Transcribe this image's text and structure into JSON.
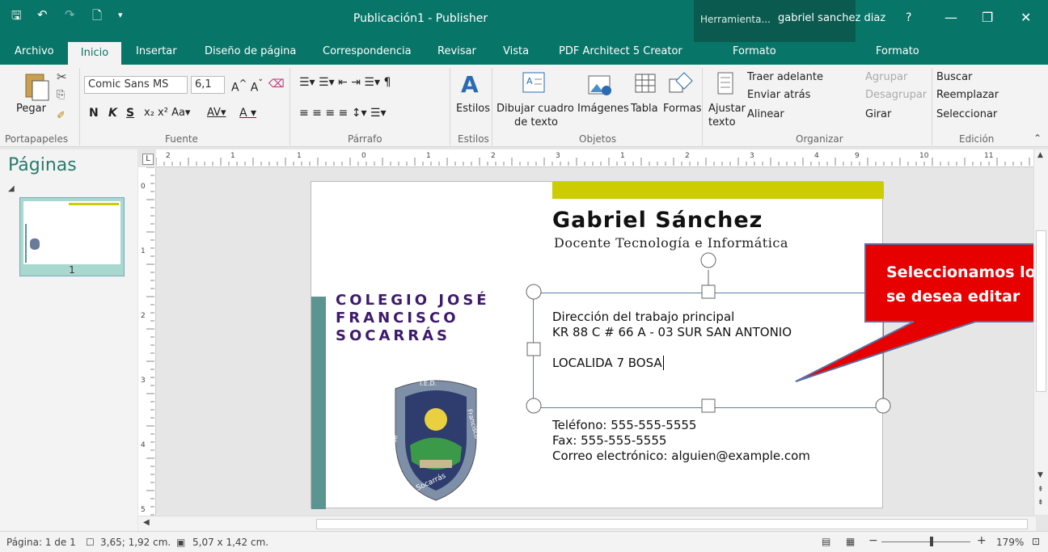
{
  "window": {
    "title": "Publicación1 - Publisher",
    "context_tab": "Herramienta...",
    "user": "gabriel sanchez diaz",
    "help": "?",
    "minimize": "—",
    "restore": "❐",
    "close": "✕"
  },
  "qat": {
    "save": "🖫",
    "undo": "↶",
    "redo": "↷",
    "new": "🗋",
    "more": "▾"
  },
  "tabs": [
    "Archivo",
    "Inicio",
    "Insertar",
    "Diseño de página",
    "Correspondencia",
    "Revisar",
    "Vista",
    "PDF Architect 5 Creator",
    "Formato",
    "Formato"
  ],
  "ribbon": {
    "pegar": "Pegar",
    "font_name": "Comic Sans MS",
    "font_size": "6,1",
    "bold": "N",
    "italic": "K",
    "underline": "S",
    "estilos": "Estilos",
    "dibujar": "Dibujar cuadro",
    "dibujar2": "de texto",
    "imagenes": "Imágenes",
    "tabla": "Tabla",
    "formas": "Formas",
    "ajustar": "Ajustar",
    "ajustar2": "texto",
    "traer": "Traer adelante",
    "enviar": "Enviar atrás",
    "alinear": "Alinear",
    "agrupar": "Agrupar",
    "desagrupar": "Desagrupar",
    "girar": "Girar",
    "buscar": "Buscar",
    "reemplazar": "Reemplazar",
    "seleccionar": "Seleccionar",
    "groups": {
      "portapapeles": "Portapapeles",
      "fuente": "Fuente",
      "parrafo": "Párrafo",
      "estilos": "Estilos",
      "objetos": "Objetos",
      "organizar": "Organizar",
      "edicion": "Edición"
    }
  },
  "ruler": {
    "corner": "L",
    "h": [
      "2",
      "1",
      "1",
      "0",
      "1",
      "2",
      "3",
      "1",
      "2",
      "3",
      "4",
      "9",
      "10",
      "11"
    ],
    "v": [
      "0",
      "1",
      "2",
      "3",
      "4",
      "5"
    ]
  },
  "pages_pane": {
    "title": "Páginas",
    "thumb_number": "1"
  },
  "card": {
    "name": "Gabriel Sánchez",
    "role": "Docente Tecnología e Informática",
    "school": [
      "COLEGIO JOSÉ",
      "FRANCISCO",
      "SOCARRÁS"
    ],
    "address_lines": [
      "Dirección del trabajo principal",
      "KR 88 C # 66 A - 03 SUR SAN ANTONIO",
      "",
      "LOCALIDA 7 BOSA"
    ],
    "contact": [
      "Teléfono: 555-555-5555",
      "Fax: 555-555-5555",
      "Correo electrónico: alguien@example.com"
    ],
    "logo_top": "I.E.D.",
    "logo_left": "José",
    "logo_right": "Francisco",
    "logo_bottom": "Socarrás"
  },
  "callout": {
    "text_line1": "Seleccionamos lo",
    "text_line2": "se desea editar"
  },
  "status": {
    "page": "Página: 1 de 1",
    "position": "3,65; 1,92 cm.",
    "size": "5,07 x  1,42 cm.",
    "zoom": "179%"
  },
  "colors": {
    "accent": "#077568",
    "card_bar": "#cccc00",
    "side_bar": "#5a9592",
    "school": "#3d1a6b",
    "callout": "#e60000"
  }
}
